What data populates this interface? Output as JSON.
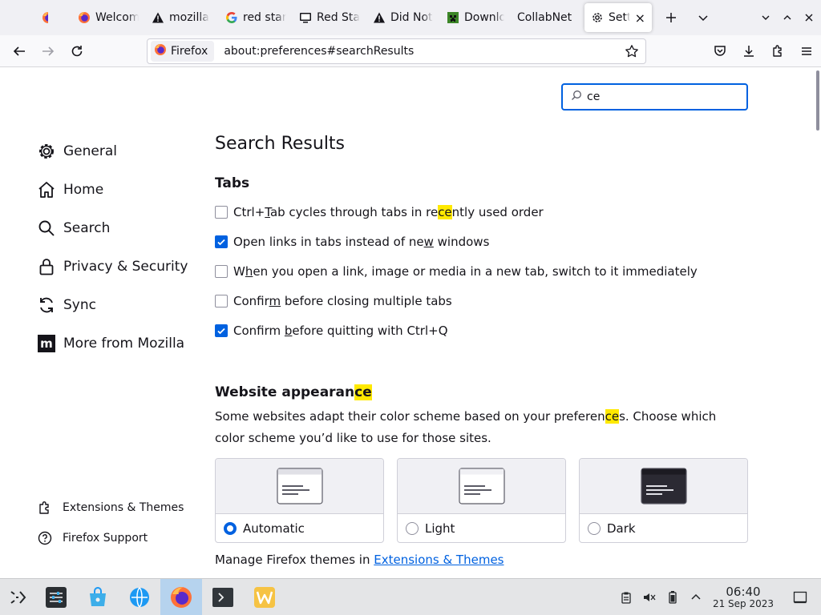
{
  "browser": {
    "tabs": [
      {
        "label": "",
        "icon": "firefox-icon"
      },
      {
        "label": "Welcom",
        "icon": "firefox-icon"
      },
      {
        "label": "mozilla",
        "icon": "warning-icon"
      },
      {
        "label": "red star",
        "icon": "google-icon"
      },
      {
        "label": "Red Sta",
        "icon": "monitor-icon"
      },
      {
        "label": "Did Not",
        "icon": "warning-icon"
      },
      {
        "label": "Downlo",
        "icon": "minecraft-icon"
      },
      {
        "label": "CollabNet",
        "icon": ""
      },
      {
        "label": "Settin",
        "icon": "gear-icon",
        "active": true
      }
    ],
    "identity_label": "Firefox",
    "url": "about:preferences#searchResults"
  },
  "prefs": {
    "search_value": "ce",
    "nav": [
      "General",
      "Home",
      "Search",
      "Privacy & Security",
      "Sync",
      "More from Mozilla"
    ],
    "subnav": [
      "Extensions & Themes",
      "Firefox Support"
    ],
    "heading": "Search Results",
    "tabs_heading": "Tabs",
    "checkboxes": [
      {
        "checked": false
      },
      {
        "checked": true
      },
      {
        "checked": false
      },
      {
        "checked": false
      },
      {
        "checked": true
      }
    ],
    "checkbox_text": {
      "c0": [
        "Ctrl+",
        "T",
        "ab cycles through tabs in re",
        "ce",
        "ntly used order"
      ],
      "c1": [
        "Open links in tabs instead of ne",
        "w",
        " windows"
      ],
      "c2": [
        "W",
        "h",
        "en you open a link, image or media in a new tab, switch to it immediately"
      ],
      "c3": [
        "Confir",
        "m",
        " before closing multiple tabs"
      ],
      "c4": [
        "Confirm ",
        "b",
        "efore quitting with Ctrl+Q"
      ]
    },
    "appearance_heading": [
      "Website appearan",
      "ce"
    ],
    "appearance_desc": [
      "Some websites adapt their color scheme based on your preferen",
      "ce",
      "s. Choose which color scheme you’d like to use for those sites."
    ],
    "schemes": [
      {
        "label": "Automatic",
        "selected": true
      },
      {
        "label": "Light",
        "selected": false
      },
      {
        "label": "Dark",
        "selected": false
      }
    ],
    "manage_text": "Manage Firefox themes in ",
    "manage_link": "Extensions & Themes"
  },
  "taskbar": {
    "time": "06:40",
    "date": "21 Sep 2023"
  },
  "colors": {
    "accent": "#0061e0",
    "highlight": "#ffe900"
  }
}
